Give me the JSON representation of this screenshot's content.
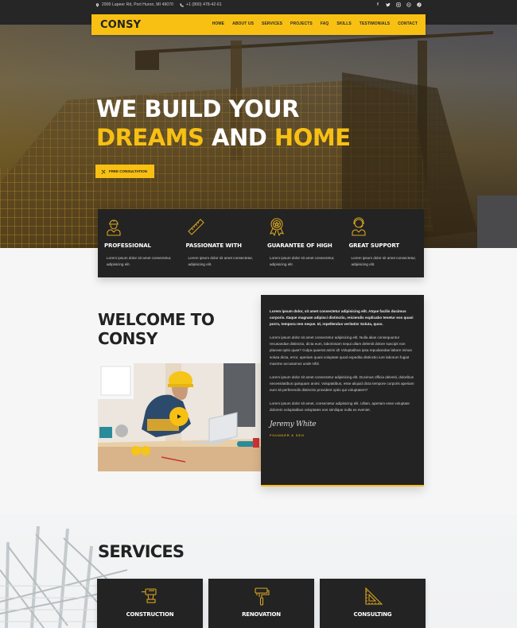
{
  "topbar": {
    "address": "2900 Lapeer Rd, Port Huron, MI 49070",
    "phone": "+1 (800) 478-42-61",
    "social": [
      "facebook-icon",
      "twitter-icon",
      "instagram-icon",
      "dribbble-icon",
      "pinterest-icon"
    ]
  },
  "nav": {
    "logo": "CONSY",
    "items": [
      "HOME",
      "ABOUT US",
      "SERVICES",
      "PROJECTS",
      "FAQ",
      "SKILLS",
      "TESTIMONIALS",
      "CONTACT"
    ]
  },
  "hero": {
    "line1": "WE BUILD YOUR",
    "line2_a": "DREAMS",
    "line2_b": "AND",
    "line2_c": "HOME",
    "cta_label": "FREE CONSULTATION",
    "cta_icon": "tools-icon"
  },
  "features": [
    {
      "icon": "worker-icon",
      "title": "PROFESSIONAL",
      "desc": "Lorem ipsum dolor sit amet consectetur, adipisicing elit."
    },
    {
      "icon": "ruler-icon",
      "title": "PASSIONATE WITH",
      "desc": "Lorem ipsum dolor sit amet consectetur, adipisicing elit."
    },
    {
      "icon": "award-icon",
      "title": "GUARANTEE OF HIGH",
      "desc": "Lorem ipsum dolor sit amet consectetur, adipisicing elit."
    },
    {
      "icon": "support-icon",
      "title": "GREAT SUPPORT",
      "desc": "Lorem ipsum dolor sit amet consectetur, adipisicing elit."
    }
  ],
  "welcome": {
    "title_line1": "WELCOME TO",
    "title_line2": "CONSY",
    "paragraphs": [
      "Lorem ipsum dolor, sit amet consectetur adipisicing elit. Atque facilis ducimus corporis. Itaque magnam adipisci distinctio, reiciendis explicabo tenetur eos quasi porro, tempora rem neque. Id, repellendus veritatis! Soluta, quos.",
      "Lorem ipsum dolor sit amet consectetur adipisicing elit. Nulla alias consequuntur recusandae distinctio, dicta eum, laboriosam sequi ullam deleniti dolore suscipit non placeat optio quas? Culpa quaerat animi id! Voluptatibus ipsa repudiandae labore minus soluta dicta, error, aperiam quasi voluptate quod expedita distinctio iure laborum fugiat maxime accusamus unde nihil.",
      "Lorem ipsum dolor sit amet consectetur adipisicing elit. Ducimus officia deleniti, doloribus necessitatibus quisquam animi. Voluptatibus, esse aliquid dicta tempore corporis aperiam eum sit perferendis distinctio provident optio qui voluptatem?",
      "Lorem ipsum dolor sit amet, consectetur adipisicing elit. Ullam, aperiam esse voluptate dolorem voluptatibus voluptates eos similique nulla ex eveniet."
    ],
    "signature": "Jeremy White",
    "role": "FOUNDER & SEO"
  },
  "services": {
    "title": "SERVICES",
    "items": [
      {
        "icon": "drill-icon",
        "label": "CONSTRUCTION"
      },
      {
        "icon": "paint-roller-icon",
        "label": "RENOVATION"
      },
      {
        "icon": "set-square-icon",
        "label": "CONSULTING"
      }
    ]
  },
  "colors": {
    "accent": "#f7c013",
    "dark": "#232323",
    "topbar": "#262626",
    "background": "#f6f6f6"
  }
}
